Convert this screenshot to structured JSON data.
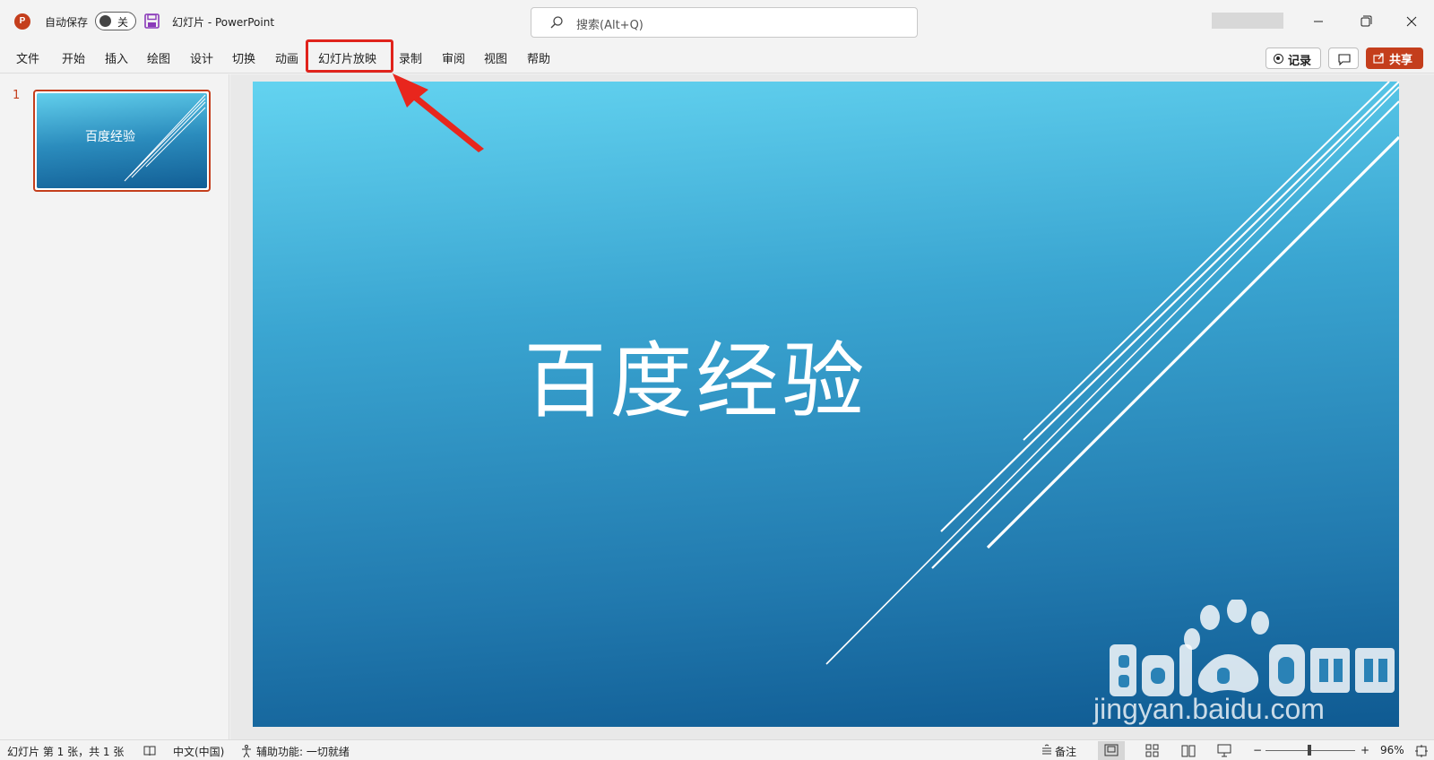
{
  "titlebar": {
    "app_logo": "P",
    "autosave_label": "自动保存",
    "autosave_state": "关",
    "doc_title": "幻灯片  -  PowerPoint",
    "search_placeholder": "搜索(Alt+Q)"
  },
  "ribbon": {
    "tabs": [
      "文件",
      "开始",
      "插入",
      "绘图",
      "设计",
      "切换",
      "动画",
      "幻灯片放映",
      "录制",
      "审阅",
      "视图",
      "帮助"
    ],
    "highlighted_tab": "幻灯片放映",
    "record_label": "记录",
    "share_label": "共享"
  },
  "thumbnails": {
    "slide_number": "1",
    "thumb_title": "百度经验"
  },
  "slide": {
    "title": "百度经验",
    "watermark_url": "jingyan.baidu.com"
  },
  "statusbar": {
    "slide_info": "幻灯片 第 1 张，共 1 张",
    "language": "中文(中国)",
    "accessibility": "辅助功能: 一切就绪",
    "notes_label": "备注",
    "zoom_level": "96%"
  },
  "colors": {
    "accent": "#c43e1c",
    "highlight_box": "#e0231c"
  }
}
